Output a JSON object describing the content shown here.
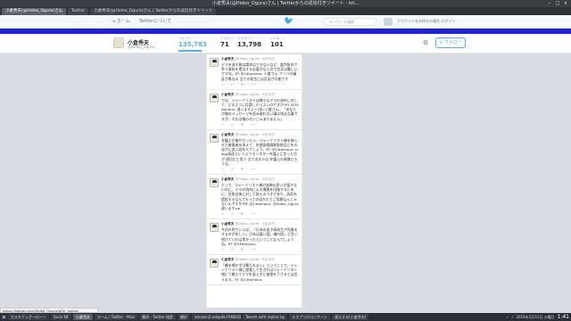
{
  "window": {
    "title": "小倉秀夫(@Hideo_Ogura)さん | Twitterからの返信付きツイート - Int..."
  },
  "tabs": [
    {
      "label": "小倉秀夫(@Hideo_Ogura)さん",
      "active": true
    },
    {
      "label": "Twitter"
    },
    {
      "label": "小倉秀夫(@Hideo_Ogura)さん | Twitterからの返信付きツイート"
    }
  ],
  "twitter_bar": {
    "home": "ホーム",
    "about": "Twitterについて",
    "search_placeholder": "キーワード検索",
    "lang": "アカウントをお持ちの場合 ログイン"
  },
  "profile": {
    "name": "小倉秀夫",
    "handle": "@Hideo_Ogura",
    "stats": [
      {
        "label": "ツイート",
        "value": "135,783",
        "active": true
      },
      {
        "label": "フォロー",
        "value": "71"
      },
      {
        "label": "フォロワー",
        "value": "13,798"
      },
      {
        "label": "いいね",
        "value": "101"
      }
    ],
    "follow_label": "フォロー"
  },
  "tweets": [
    {
      "name": "小倉秀夫",
      "handle": "@Hideo_Ogura · 5月30日",
      "text": "デマを流す側は請求はできないなど、裁判所内で争う資料を提出する必要がないので言及は難しいですね。RT @24tamano: 小倉さん アリバの議証が異なる 全ての発言には反証が可能です"
    },
    {
      "name": "小倉秀夫",
      "handle": "@Hideo_Ogura · 5月30日",
      "text": "では、ジャーナリストは様々なデマの流布に対して、どのように反論したらよいのですか?RT @24tamano: 違いますよ〜(笑) 小倉さん。「あなたが僕のメッセージを読み取れない事は残念な事ですが、それは僕のせいじゃありません」"
    },
    {
      "name": "小倉秀夫",
      "handle": "@Hideo_Ogura · 5月30日",
      "text": "弁護士が書かだったら、ジャーナリスト様を取らせた被害者を訴えて、名誉毀損損害賠償などをのほかに追い詰めたでしょう。RT @24tamano: slapp訴訟というよりモンスター弁護士に言った方が 適切だと思う 全ての方々は 弁護士の資質だろうな。"
    },
    {
      "name": "小倉秀夫",
      "handle": "@Hideo_Ogura · 5月30日",
      "text": "だって、ジャーナリスト様の皆様の思いが届かないのに、デマの流布による損害を回復するために、目更自体に対して訴えるべきであり、訴訟を提起するなんてもってのほかだとご見解なんじゃないんですか?RT @24tamano: @Hideo_Ogura 違いますyw"
    },
    {
      "name": "小倉秀夫",
      "handle": "@Hideo_Ogura · 5月30日",
      "text": "今回の例でいえば、「日本の女子高校生が売春をするのが珍しい」日本は悪い国、嫌の国」と言い続けていれば良かったということなんでしょうね。RT @24tamano:"
    },
    {
      "name": "小倉秀夫",
      "handle": "@Hideo_Ogura · 5月30日",
      "text": "「鶴を鳴かずば撃たれまい」ということで、ジャーナリスト様に提案して生きればジャーナリスト様にて敵えてデマを訴えずに被害を下さるとは言えます。RT @24tamano:"
    }
  ],
  "status_url": "https://twitter.com/Hideo_Ogura/with_replies",
  "taskbar": [
    {
      "label": "カスタブッグーローー"
    },
    {
      "label": "Quriz-NF"
    },
    {
      "label": "小倉秀夫",
      "active": true
    },
    {
      "label": "ホーム / Twitter - Mozi"
    },
    {
      "label": "翻訳 - Twitter 検索"
    },
    {
      "label": "翻訳"
    },
    {
      "label": "amazon2-adepdk-FANSUD"
    },
    {
      "label": "Tweets with replies by"
    },
    {
      "label": "エスプリロコンサート"
    },
    {
      "label": "表示する[小倉秀夫]"
    },
    {
      "label": "キャプチャ"
    }
  ],
  "tray": {
    "date": "2016年5月31日 火曜日",
    "time": "1:41"
  }
}
